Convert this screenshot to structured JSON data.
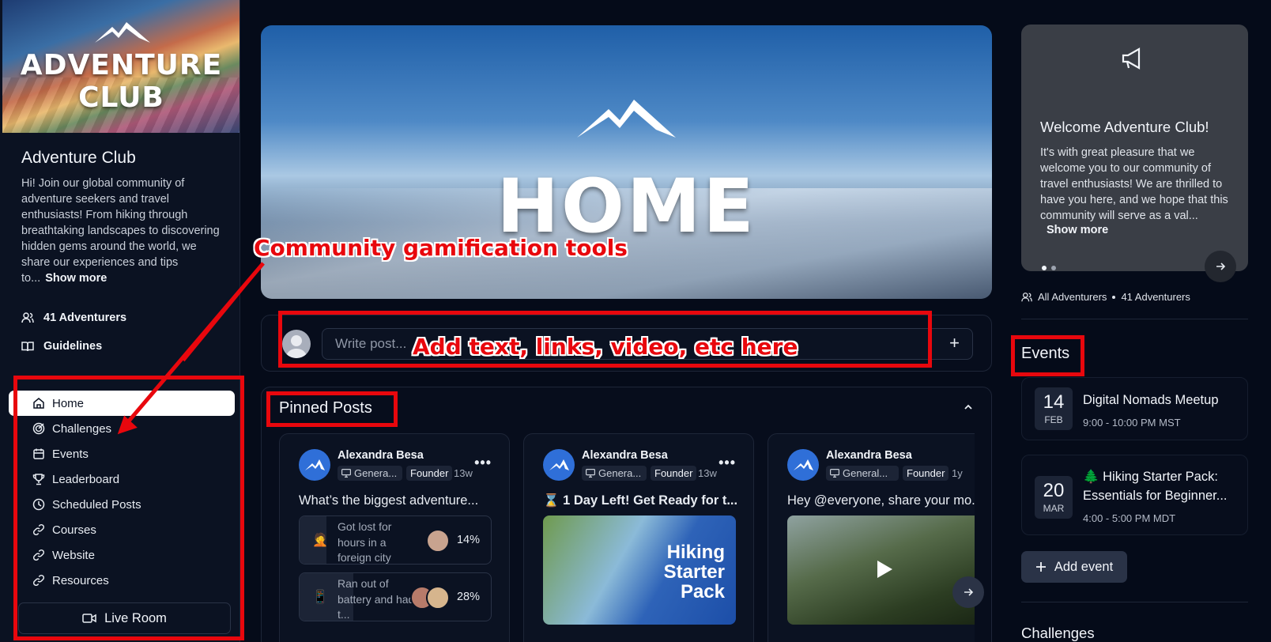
{
  "sidebar": {
    "logo_line1": "ADVENTURE",
    "logo_line2": "CLUB",
    "club_title": "Adventure Club",
    "description": "Hi! Join our global community of adventure seekers and travel enthusiasts! From hiking through breathtaking landscapes to discovering hidden gems around the world, we share our experiences and tips to...",
    "show_more": "Show more",
    "members": "41 Adventurers",
    "guidelines": "Guidelines",
    "nav": [
      {
        "label": "Home",
        "icon": "home-icon",
        "active": true
      },
      {
        "label": "Challenges",
        "icon": "target-icon"
      },
      {
        "label": "Events",
        "icon": "calendar-icon"
      },
      {
        "label": "Leaderboard",
        "icon": "trophy-icon"
      },
      {
        "label": "Scheduled Posts",
        "icon": "clock-icon"
      },
      {
        "label": "Courses",
        "icon": "link-icon"
      },
      {
        "label": "Website",
        "icon": "link-icon"
      },
      {
        "label": "Resources",
        "icon": "link-icon"
      }
    ],
    "live_room": "Live Room"
  },
  "hero": {
    "title": "HOME"
  },
  "composer": {
    "placeholder": "Write post...",
    "add": "+"
  },
  "pinned": {
    "title": "Pinned Posts",
    "cards": [
      {
        "author": "Alexandra Besa",
        "category": "Genera...",
        "role": "Founder",
        "age": "13w",
        "title": "What’s the biggest adventure...",
        "poll": [
          {
            "emoji": "🤦",
            "text": "Got lost for hours in a foreign city",
            "pct": "14%",
            "share": 0.14
          },
          {
            "emoji": "📱",
            "text": "Ran out of battery and had t...",
            "pct": "28%",
            "share": 0.28
          }
        ]
      },
      {
        "author": "Alexandra Besa",
        "category": "Genera...",
        "role": "Founder",
        "age": "13w",
        "title": "⌛ 1 Day Left! Get Ready for t...",
        "image_text": [
          "Hiking",
          "Starter",
          "Pack"
        ]
      },
      {
        "author": "Alexandra Besa",
        "category": "General...",
        "role": "Founder",
        "age": "1y",
        "title": "Hey @everyone, share your mo..."
      }
    ]
  },
  "welcome": {
    "title": "Welcome Adventure Club!",
    "body": "It's with great pleasure that we welcome you to our community of travel enthusiasts! We are thrilled to have you here, and we hope that this community will serve as a val...",
    "show_more": "Show more",
    "all_adventurers": "All Adventurers",
    "count": "41 Adventurers"
  },
  "events": {
    "title": "Events",
    "items": [
      {
        "day": "14",
        "month": "FEB",
        "title": "Digital Nomads Meetup",
        "time": "9:00 - 10:00 PM MST"
      },
      {
        "day": "20",
        "month": "MAR",
        "title": "🌲 Hiking Starter Pack: Essentials for Beginner...",
        "time": "4:00 - 5:00 PM MDT"
      }
    ],
    "add_event": "Add event"
  },
  "challenges": {
    "title": "Challenges"
  },
  "annotations": {
    "gamification": "Community gamification tools",
    "composer_hint": "Add text, links, video, etc here"
  },
  "colors": {
    "annotation": "#e8070d",
    "background": "#050b19",
    "card_bg": "#3a3e46"
  }
}
